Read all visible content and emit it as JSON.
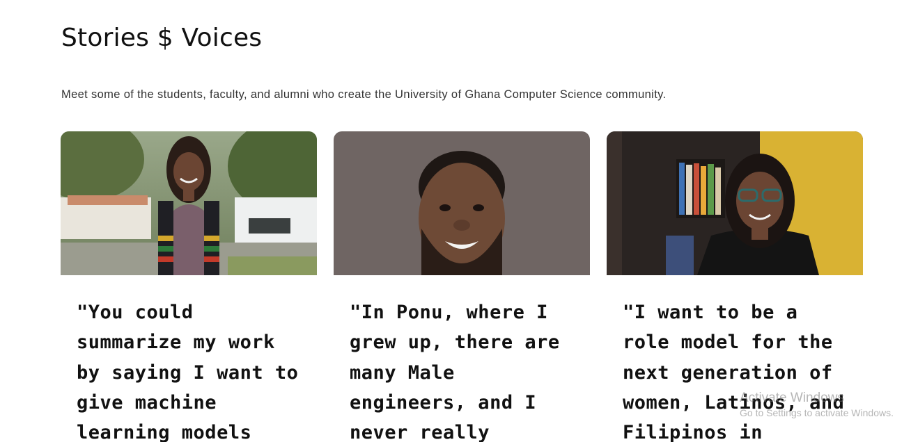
{
  "header": {
    "title": "Stories $ Voices",
    "subtitle": "Meet some of the students, faculty, and alumni who create the University of Ghana Computer Science community."
  },
  "cards": [
    {
      "quote": "\"You could summarize my work by saying I want to give machine learning models",
      "photo": "graduate-student-portrait"
    },
    {
      "quote": "\"In Ponu, where I grew up, there are many Male engineers, and I never really",
      "photo": "smiling-man-portrait"
    },
    {
      "quote": "\"I want to be a role model for the next generation of women, Latinos, and Filipinos in",
      "photo": "woman-with-glasses-portrait"
    }
  ],
  "watermark": {
    "title": "Activate Windows",
    "subtitle": "Go to Settings to activate Windows."
  },
  "colors": {
    "background": "#ffffff",
    "text": "#111111",
    "subtitle_text": "#333333"
  }
}
